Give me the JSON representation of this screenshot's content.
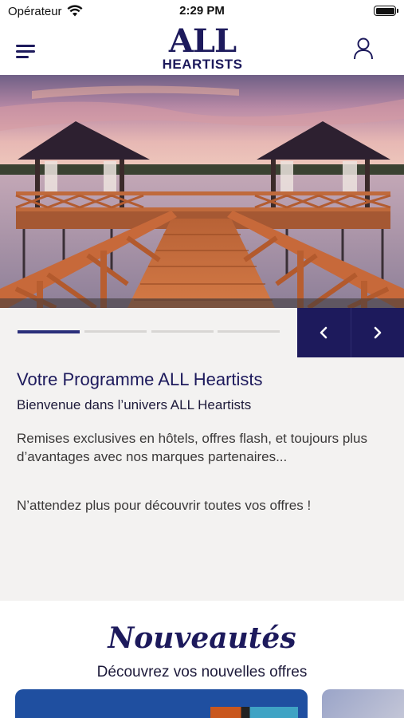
{
  "status_bar": {
    "carrier": "Opérateur",
    "time": "2:29 PM"
  },
  "header": {
    "logo_line1": "ALL",
    "logo_line2": "HEARTISTS",
    "brand_color": "#1d1a5c"
  },
  "hero": {
    "image": "gazebo-pier-sunset-photo"
  },
  "carousel": {
    "slide_count": 4,
    "active_index": 0,
    "prev_icon": "chevron-left-icon",
    "next_icon": "chevron-right-icon"
  },
  "content": {
    "title": "Votre Programme ALL Heartists",
    "subtitle": "Bienvenue dans l’univers ALL Heartists",
    "body": "Remises exclusives en hôtels, offres flash, et toujours plus d’avantages avec nos marques partenaires...",
    "cta": "N’attendez plus pour découvrir toutes vos offres !"
  },
  "news": {
    "title": "Nouveautés",
    "subtitle": "Découvrez vos nouvelles offres"
  }
}
